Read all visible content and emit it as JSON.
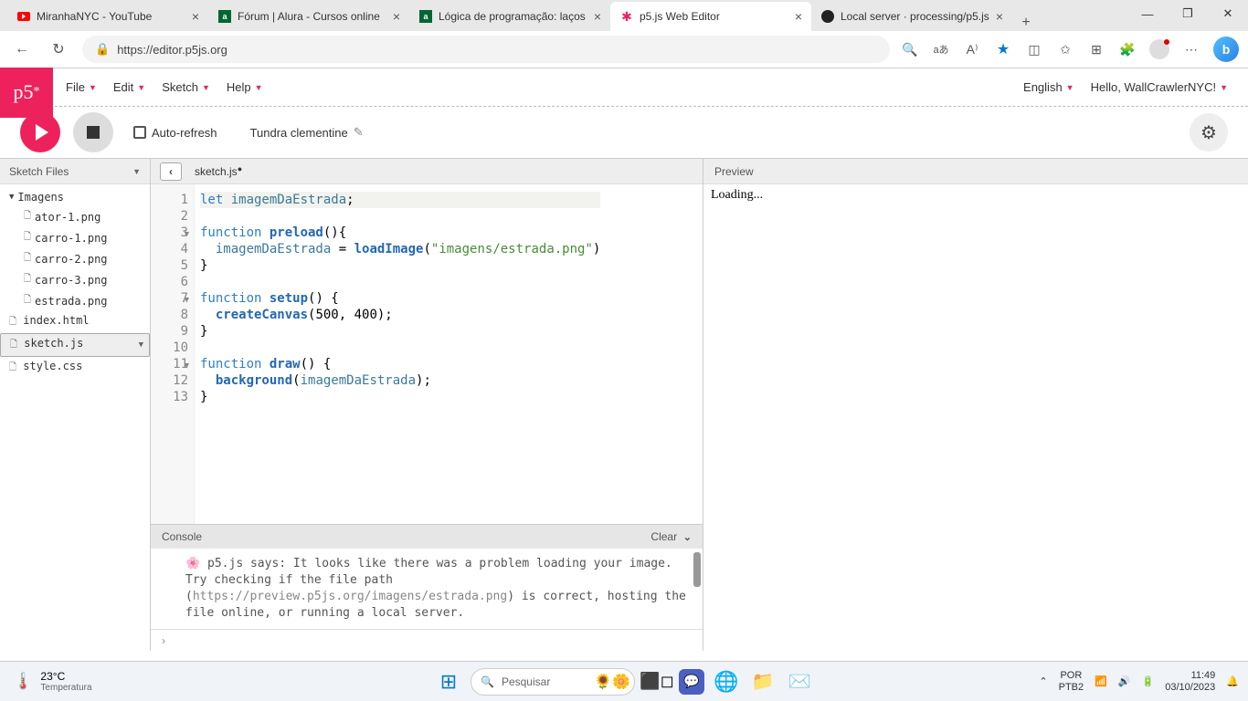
{
  "browser": {
    "tabs": [
      {
        "title": "MiranhaNYC - YouTube",
        "favicon": "yt"
      },
      {
        "title": "Fórum | Alura - Cursos online",
        "favicon": "alura"
      },
      {
        "title": "Lógica de programação: laços",
        "favicon": "alura"
      },
      {
        "title": "p5.js Web Editor",
        "favicon": "p5",
        "active": true
      },
      {
        "title": "Local server · processing/p5.js",
        "favicon": "gh"
      }
    ],
    "url": "https://editor.p5js.org"
  },
  "p5": {
    "menus": [
      "File",
      "Edit",
      "Sketch",
      "Help"
    ],
    "language": "English",
    "greeting": "Hello, WallCrawlerNYC!",
    "autorefresh_label": "Auto-refresh",
    "sketch_name": "Tundra clementine",
    "sidebar_header": "Sketch Files",
    "files": {
      "folder": "Imagens",
      "images": [
        "ator-1.png",
        "carro-1.png",
        "carro-2.png",
        "carro-3.png",
        "estrada.png"
      ],
      "root": [
        "index.html",
        "sketch.js",
        "style.css"
      ],
      "selected": "sketch.js"
    },
    "editor_tab": "sketch.js",
    "code_lines": [
      {
        "n": 1,
        "tokens": [
          [
            "kw",
            "let "
          ],
          [
            "var",
            "imagemDaEstrada"
          ],
          [
            "",
            ";"
          ]
        ],
        "hl": true
      },
      {
        "n": 2,
        "tokens": [
          [
            "",
            ""
          ]
        ]
      },
      {
        "n": 3,
        "fold": true,
        "tokens": [
          [
            "kw",
            "function "
          ],
          [
            "builtin",
            "preload"
          ],
          [
            "",
            "(){"
          ]
        ]
      },
      {
        "n": 4,
        "tokens": [
          [
            "",
            "  "
          ],
          [
            "var",
            "imagemDaEstrada"
          ],
          [
            "",
            " = "
          ],
          [
            "builtin",
            "loadImage"
          ],
          [
            "",
            "("
          ],
          [
            "str",
            "\"imagens/estrada.png\""
          ],
          [
            "",
            ")"
          ]
        ]
      },
      {
        "n": 5,
        "tokens": [
          [
            "",
            "}"
          ]
        ]
      },
      {
        "n": 6,
        "tokens": [
          [
            "",
            ""
          ]
        ]
      },
      {
        "n": 7,
        "fold": true,
        "tokens": [
          [
            "kw",
            "function "
          ],
          [
            "builtin",
            "setup"
          ],
          [
            "",
            "() {"
          ]
        ]
      },
      {
        "n": 8,
        "tokens": [
          [
            "",
            "  "
          ],
          [
            "builtin",
            "createCanvas"
          ],
          [
            "",
            "(500, 400);"
          ]
        ]
      },
      {
        "n": 9,
        "tokens": [
          [
            "",
            "}"
          ]
        ]
      },
      {
        "n": 10,
        "tokens": [
          [
            "",
            ""
          ]
        ]
      },
      {
        "n": 11,
        "fold": true,
        "tokens": [
          [
            "kw",
            "function "
          ],
          [
            "builtin",
            "draw"
          ],
          [
            "",
            "() {"
          ]
        ]
      },
      {
        "n": 12,
        "tokens": [
          [
            "",
            "  "
          ],
          [
            "builtin",
            "background"
          ],
          [
            "",
            "("
          ],
          [
            "var",
            "imagemDaEstrada"
          ],
          [
            "",
            ");"
          ]
        ]
      },
      {
        "n": 13,
        "tokens": [
          [
            "",
            "}"
          ]
        ]
      }
    ],
    "console": {
      "header": "Console",
      "clear": "Clear",
      "msg_pre": "🌸 p5.js says: It looks like there was a problem loading your image. Try checking if the file path (",
      "msg_link": "https://preview.p5js.org/imagens/estrada.png",
      "msg_post": ") is correct, hosting the file online, or running a local server."
    },
    "preview_header": "Preview",
    "preview_body": "Loading..."
  },
  "taskbar": {
    "temp": "23°C",
    "temp_label": "Temperatura",
    "search_placeholder": "Pesquisar",
    "lang1": "POR",
    "lang2": "PTB2",
    "time": "11:49",
    "date": "03/10/2023"
  }
}
